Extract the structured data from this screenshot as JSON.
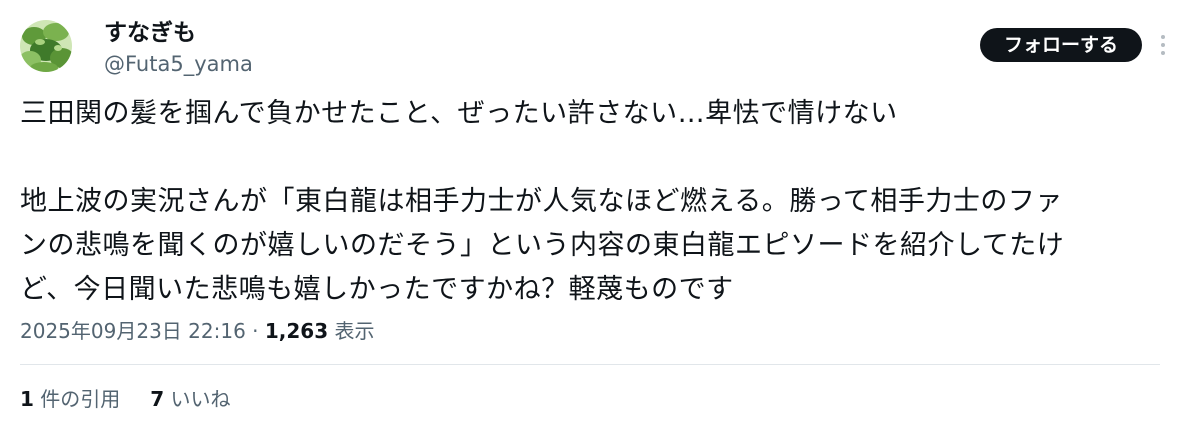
{
  "author": {
    "display_name": "すなぎも",
    "handle": "@Futa5_yama",
    "avatar_icon": "avatar-leaf-photo"
  },
  "actions": {
    "follow_label": "フォローする",
    "more_icon": "more-vertical-icon"
  },
  "tweet": {
    "lines": [
      "三田関の髪を掴んで負かせたこと、ぜったい許さない…卑怯で情けない",
      "",
      "地上波の実況さんが「東白龍は相手力士が人気なほど燃える。勝って相手力士のファ",
      "ンの悲鳴を聞くのが嬉しいのだそう」という内容の東白龍エピソードを紹介してたけ",
      "ど、今日聞いた悲鳴も嬉しかったですかね？軽蔑ものです"
    ]
  },
  "meta": {
    "timestamp": "2025年09月23日 22:16",
    "separator": " · ",
    "views_count": "1,263",
    "views_label": " 表示"
  },
  "stats": {
    "quotes_count": "1",
    "quotes_label": " 件の引用",
    "likes_count": "7",
    "likes_label": " いいね"
  },
  "colors": {
    "text_primary": "#0f1419",
    "text_secondary": "#536471",
    "button_bg": "#0f1419",
    "divider": "#e1e6ea"
  }
}
